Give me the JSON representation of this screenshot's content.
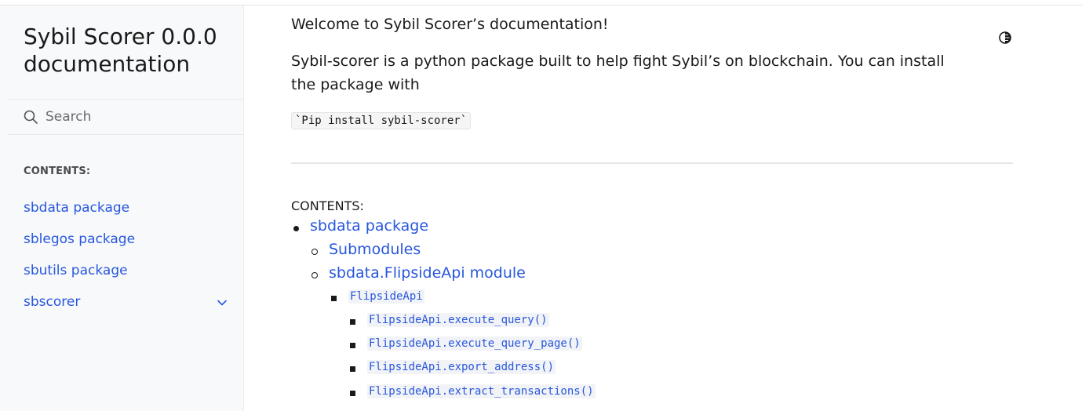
{
  "sidebar": {
    "brand": "Sybil Scorer 0.0.0 documentation",
    "search": {
      "placeholder": "Search"
    },
    "caption": "CONTENTS:",
    "items": [
      {
        "label": "sbdata package"
      },
      {
        "label": "sblegos package"
      },
      {
        "label": "sbutils package"
      },
      {
        "label": "sbscorer"
      }
    ]
  },
  "main": {
    "heading": "Welcome to Sybil Scorer’s documentation!",
    "intro": "Sybil-scorer is a python package built to help fight Sybil’s on blockchain. You can install the package with",
    "install_code": "`Pip install sybil-scorer`",
    "toc_caption": "CONTENTS:",
    "toc": {
      "level1": "sbdata package",
      "level2": [
        "Submodules",
        "sbdata.FlipsideApi module"
      ],
      "level3": "FlipsideApi",
      "level4": [
        "FlipsideApi.execute_query()",
        "FlipsideApi.execute_query_page()",
        "FlipsideApi.export_address()",
        "FlipsideApi.extract_transactions()"
      ]
    }
  },
  "icons": {
    "search": "search-icon",
    "chevron": "chevron-down-icon",
    "theme": "theme-toggle-icon"
  },
  "colors": {
    "link": "#2757dd",
    "sidebar_bg": "#f8f9fb"
  }
}
